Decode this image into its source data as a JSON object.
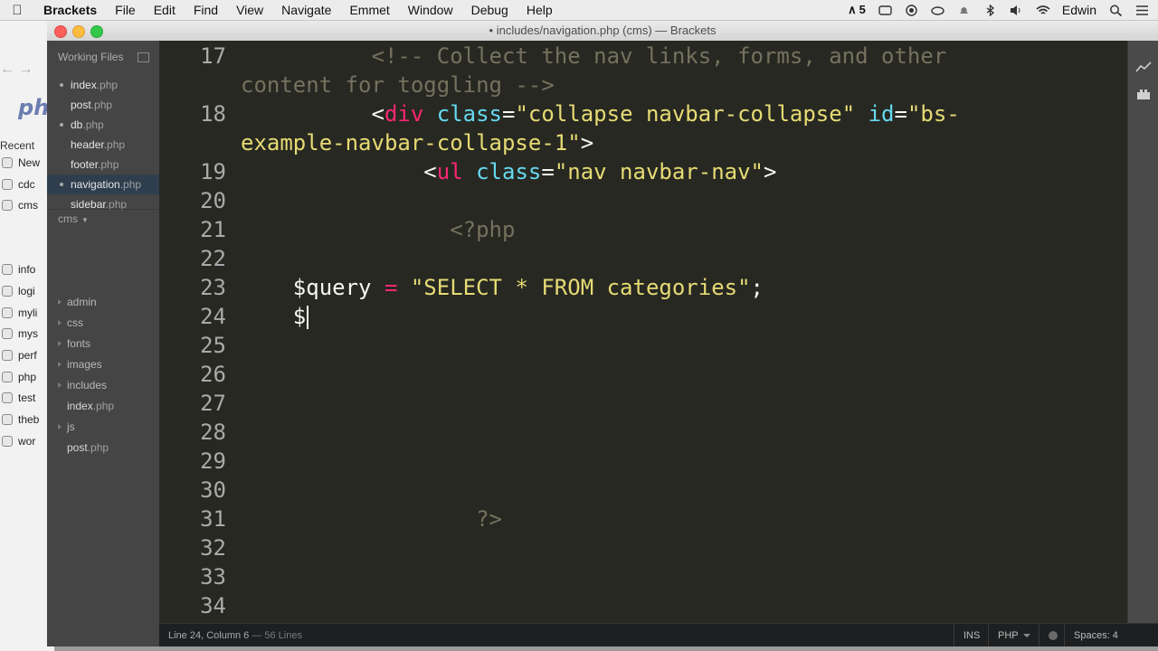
{
  "menubar": {
    "app": "Brackets",
    "items": [
      "File",
      "Edit",
      "Find",
      "View",
      "Navigate",
      "Emmet",
      "Window",
      "Debug",
      "Help"
    ],
    "tray_badge": "5",
    "user": "Edwin"
  },
  "background_window": {
    "logo_text": "php",
    "recent_label": "Recent",
    "items": [
      "New",
      "cdc",
      "cms",
      "info",
      "logi",
      "myli",
      "mys",
      "perf",
      "php",
      "test",
      "theb",
      "wor"
    ]
  },
  "window": {
    "title": "• includes/navigation.php (cms) — Brackets"
  },
  "sidebar": {
    "working_files_label": "Working Files",
    "working_files": [
      {
        "name": "index",
        "ext": ".php"
      },
      {
        "name": "post",
        "ext": ".php"
      },
      {
        "name": "db",
        "ext": ".php"
      },
      {
        "name": "header",
        "ext": ".php"
      },
      {
        "name": "footer",
        "ext": ".php"
      },
      {
        "name": "navigation",
        "ext": ".php"
      },
      {
        "name": "sidebar",
        "ext": ".php"
      }
    ],
    "active_file": "navigation.php",
    "project_label": "cms",
    "project_items": [
      {
        "name": "admin",
        "ext": "",
        "folder": true
      },
      {
        "name": "css",
        "ext": "",
        "folder": true
      },
      {
        "name": "fonts",
        "ext": "",
        "folder": true
      },
      {
        "name": "images",
        "ext": "",
        "folder": true
      },
      {
        "name": "includes",
        "ext": "",
        "folder": true
      },
      {
        "name": "index",
        "ext": ".php",
        "folder": false
      },
      {
        "name": "js",
        "ext": "",
        "folder": true
      },
      {
        "name": "post",
        "ext": ".php",
        "folder": false
      }
    ]
  },
  "editor": {
    "line_numbers": [
      "17",
      "",
      "18",
      "",
      "19",
      "20",
      "21",
      "22",
      "23",
      "24",
      "25",
      "26",
      "27",
      "28",
      "29",
      "30",
      "31",
      "32",
      "33",
      "34"
    ],
    "lines": {
      "l17a_indent": "          ",
      "l17a_comment": "<!-- Collect the nav links, forms, and other",
      "l17b_comment": "content for toggling -->",
      "l18a_indent": "          ",
      "l18a_lt": "<",
      "l18a_tag": "div",
      "l18a_attr1": " class",
      "l18a_eq1": "=",
      "l18a_val1": "\"collapse navbar-collapse\"",
      "l18a_attr2": " id",
      "l18a_eq2": "=",
      "l18a_val2a": "\"bs-",
      "l18b_val2b": "example-navbar-collapse-1\"",
      "l18b_gt": ">",
      "l19_indent": "              ",
      "l19_lt": "<",
      "l19_tag": "ul",
      "l19_attr": " class",
      "l19_eq": "=",
      "l19_val": "\"nav navbar-nav\"",
      "l19_gt": ">",
      "l21_indent": "                ",
      "l21_php": "<?php",
      "l23_indent": "    ",
      "l23_var": "$query ",
      "l23_op": "=",
      "l23_str": " \"SELECT * FROM categories\"",
      "l23_end": ";",
      "l24_indent": "    ",
      "l24_text": "$",
      "l31_indent": "                  ",
      "l31_php": "?>"
    }
  },
  "statusbar": {
    "position": "Line 24, Column 6",
    "lines": " — 56 Lines",
    "mode": "INS",
    "language": "PHP",
    "spaces": "Spaces: 4"
  }
}
